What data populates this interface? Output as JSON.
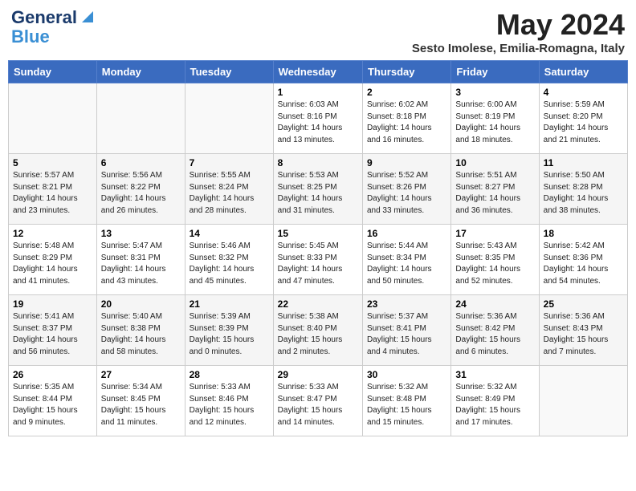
{
  "header": {
    "logo_general": "General",
    "logo_blue": "Blue",
    "month_title": "May 2024",
    "subtitle": "Sesto Imolese, Emilia-Romagna, Italy"
  },
  "weekdays": [
    "Sunday",
    "Monday",
    "Tuesday",
    "Wednesday",
    "Thursday",
    "Friday",
    "Saturday"
  ],
  "weeks": [
    [
      {
        "day": "",
        "info": ""
      },
      {
        "day": "",
        "info": ""
      },
      {
        "day": "",
        "info": ""
      },
      {
        "day": "1",
        "info": "Sunrise: 6:03 AM\nSunset: 8:16 PM\nDaylight: 14 hours\nand 13 minutes."
      },
      {
        "day": "2",
        "info": "Sunrise: 6:02 AM\nSunset: 8:18 PM\nDaylight: 14 hours\nand 16 minutes."
      },
      {
        "day": "3",
        "info": "Sunrise: 6:00 AM\nSunset: 8:19 PM\nDaylight: 14 hours\nand 18 minutes."
      },
      {
        "day": "4",
        "info": "Sunrise: 5:59 AM\nSunset: 8:20 PM\nDaylight: 14 hours\nand 21 minutes."
      }
    ],
    [
      {
        "day": "5",
        "info": "Sunrise: 5:57 AM\nSunset: 8:21 PM\nDaylight: 14 hours\nand 23 minutes."
      },
      {
        "day": "6",
        "info": "Sunrise: 5:56 AM\nSunset: 8:22 PM\nDaylight: 14 hours\nand 26 minutes."
      },
      {
        "day": "7",
        "info": "Sunrise: 5:55 AM\nSunset: 8:24 PM\nDaylight: 14 hours\nand 28 minutes."
      },
      {
        "day": "8",
        "info": "Sunrise: 5:53 AM\nSunset: 8:25 PM\nDaylight: 14 hours\nand 31 minutes."
      },
      {
        "day": "9",
        "info": "Sunrise: 5:52 AM\nSunset: 8:26 PM\nDaylight: 14 hours\nand 33 minutes."
      },
      {
        "day": "10",
        "info": "Sunrise: 5:51 AM\nSunset: 8:27 PM\nDaylight: 14 hours\nand 36 minutes."
      },
      {
        "day": "11",
        "info": "Sunrise: 5:50 AM\nSunset: 8:28 PM\nDaylight: 14 hours\nand 38 minutes."
      }
    ],
    [
      {
        "day": "12",
        "info": "Sunrise: 5:48 AM\nSunset: 8:29 PM\nDaylight: 14 hours\nand 41 minutes."
      },
      {
        "day": "13",
        "info": "Sunrise: 5:47 AM\nSunset: 8:31 PM\nDaylight: 14 hours\nand 43 minutes."
      },
      {
        "day": "14",
        "info": "Sunrise: 5:46 AM\nSunset: 8:32 PM\nDaylight: 14 hours\nand 45 minutes."
      },
      {
        "day": "15",
        "info": "Sunrise: 5:45 AM\nSunset: 8:33 PM\nDaylight: 14 hours\nand 47 minutes."
      },
      {
        "day": "16",
        "info": "Sunrise: 5:44 AM\nSunset: 8:34 PM\nDaylight: 14 hours\nand 50 minutes."
      },
      {
        "day": "17",
        "info": "Sunrise: 5:43 AM\nSunset: 8:35 PM\nDaylight: 14 hours\nand 52 minutes."
      },
      {
        "day": "18",
        "info": "Sunrise: 5:42 AM\nSunset: 8:36 PM\nDaylight: 14 hours\nand 54 minutes."
      }
    ],
    [
      {
        "day": "19",
        "info": "Sunrise: 5:41 AM\nSunset: 8:37 PM\nDaylight: 14 hours\nand 56 minutes."
      },
      {
        "day": "20",
        "info": "Sunrise: 5:40 AM\nSunset: 8:38 PM\nDaylight: 14 hours\nand 58 minutes."
      },
      {
        "day": "21",
        "info": "Sunrise: 5:39 AM\nSunset: 8:39 PM\nDaylight: 15 hours\nand 0 minutes."
      },
      {
        "day": "22",
        "info": "Sunrise: 5:38 AM\nSunset: 8:40 PM\nDaylight: 15 hours\nand 2 minutes."
      },
      {
        "day": "23",
        "info": "Sunrise: 5:37 AM\nSunset: 8:41 PM\nDaylight: 15 hours\nand 4 minutes."
      },
      {
        "day": "24",
        "info": "Sunrise: 5:36 AM\nSunset: 8:42 PM\nDaylight: 15 hours\nand 6 minutes."
      },
      {
        "day": "25",
        "info": "Sunrise: 5:36 AM\nSunset: 8:43 PM\nDaylight: 15 hours\nand 7 minutes."
      }
    ],
    [
      {
        "day": "26",
        "info": "Sunrise: 5:35 AM\nSunset: 8:44 PM\nDaylight: 15 hours\nand 9 minutes."
      },
      {
        "day": "27",
        "info": "Sunrise: 5:34 AM\nSunset: 8:45 PM\nDaylight: 15 hours\nand 11 minutes."
      },
      {
        "day": "28",
        "info": "Sunrise: 5:33 AM\nSunset: 8:46 PM\nDaylight: 15 hours\nand 12 minutes."
      },
      {
        "day": "29",
        "info": "Sunrise: 5:33 AM\nSunset: 8:47 PM\nDaylight: 15 hours\nand 14 minutes."
      },
      {
        "day": "30",
        "info": "Sunrise: 5:32 AM\nSunset: 8:48 PM\nDaylight: 15 hours\nand 15 minutes."
      },
      {
        "day": "31",
        "info": "Sunrise: 5:32 AM\nSunset: 8:49 PM\nDaylight: 15 hours\nand 17 minutes."
      },
      {
        "day": "",
        "info": ""
      }
    ]
  ]
}
